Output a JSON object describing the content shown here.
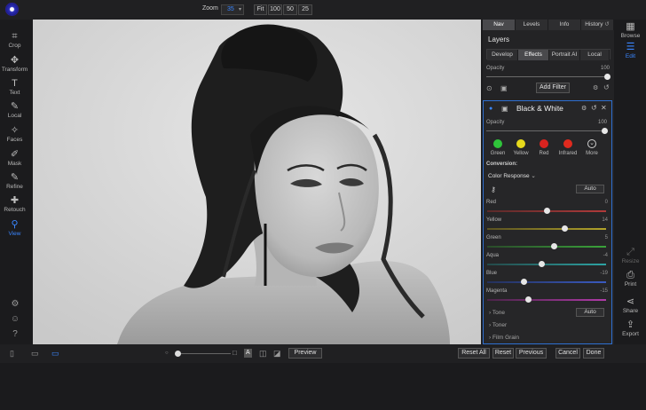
{
  "topbar": {
    "zoom_label": "Zoom",
    "zoom_value": "35",
    "zoom_buttons": [
      "Fit",
      "100",
      "50",
      "25"
    ]
  },
  "left_tools": [
    {
      "label": "Crop",
      "icon": "crop-icon"
    },
    {
      "label": "Transform",
      "icon": "transform-icon"
    },
    {
      "label": "Text",
      "icon": "text-icon"
    },
    {
      "label": "Local",
      "icon": "brush-icon"
    },
    {
      "label": "Faces",
      "icon": "faces-icon"
    },
    {
      "label": "Mask",
      "icon": "mask-icon"
    },
    {
      "label": "Refine",
      "icon": "refine-icon"
    },
    {
      "label": "Retouch",
      "icon": "retouch-icon"
    },
    {
      "label": "View",
      "icon": "view-icon"
    }
  ],
  "panel": {
    "tabs": [
      "Nav",
      "Levels",
      "Info",
      "History"
    ],
    "layers_title": "Layers",
    "layer_tabs": [
      "Develop",
      "Effects",
      "Portrait AI",
      "Local"
    ],
    "opacity_label": "Opacity",
    "opacity_value": "100",
    "add_filter": "Add Filter",
    "filter": {
      "title": "Black & White",
      "opacity_label": "Opacity",
      "opacity_value": "100",
      "colors": [
        {
          "label": "Green",
          "color": "#2fc43a"
        },
        {
          "label": "Yellow",
          "color": "#e6d91c"
        },
        {
          "label": "Red",
          "color": "#d9231f"
        },
        {
          "label": "Infrared",
          "color": "#e02a1e"
        },
        {
          "label": "More",
          "color": "more"
        }
      ],
      "conversion_label": "Conversion:",
      "conversion_value": "Color Response",
      "auto_label": "Auto",
      "adjustments": [
        {
          "label": "Red",
          "value": "0",
          "level": 0.5
        },
        {
          "label": "Yellow",
          "value": "14",
          "level": 0.65
        },
        {
          "label": "Green",
          "value": "5",
          "level": 0.56
        },
        {
          "label": "Aqua",
          "value": "-4",
          "level": 0.46
        },
        {
          "label": "Blue",
          "value": "-19",
          "level": 0.31
        },
        {
          "label": "Magenta",
          "value": "-15",
          "level": 0.35
        }
      ],
      "tone_label": "Tone",
      "tone_auto": "Auto",
      "toner_label": "Toner",
      "grain_label": "Film Grain"
    }
  },
  "right_tools": [
    {
      "label": "Browse",
      "state": "normal"
    },
    {
      "label": "Edit",
      "state": "active"
    },
    {
      "label": "Resize",
      "state": "dim"
    },
    {
      "label": "Print",
      "state": "normal"
    },
    {
      "label": "Share",
      "state": "normal"
    },
    {
      "label": "Export",
      "state": "normal"
    }
  ],
  "bottombar": {
    "preview": "Preview",
    "reset_all": "Reset All",
    "reset": "Reset",
    "previous": "Previous",
    "cancel": "Cancel",
    "done": "Done"
  }
}
